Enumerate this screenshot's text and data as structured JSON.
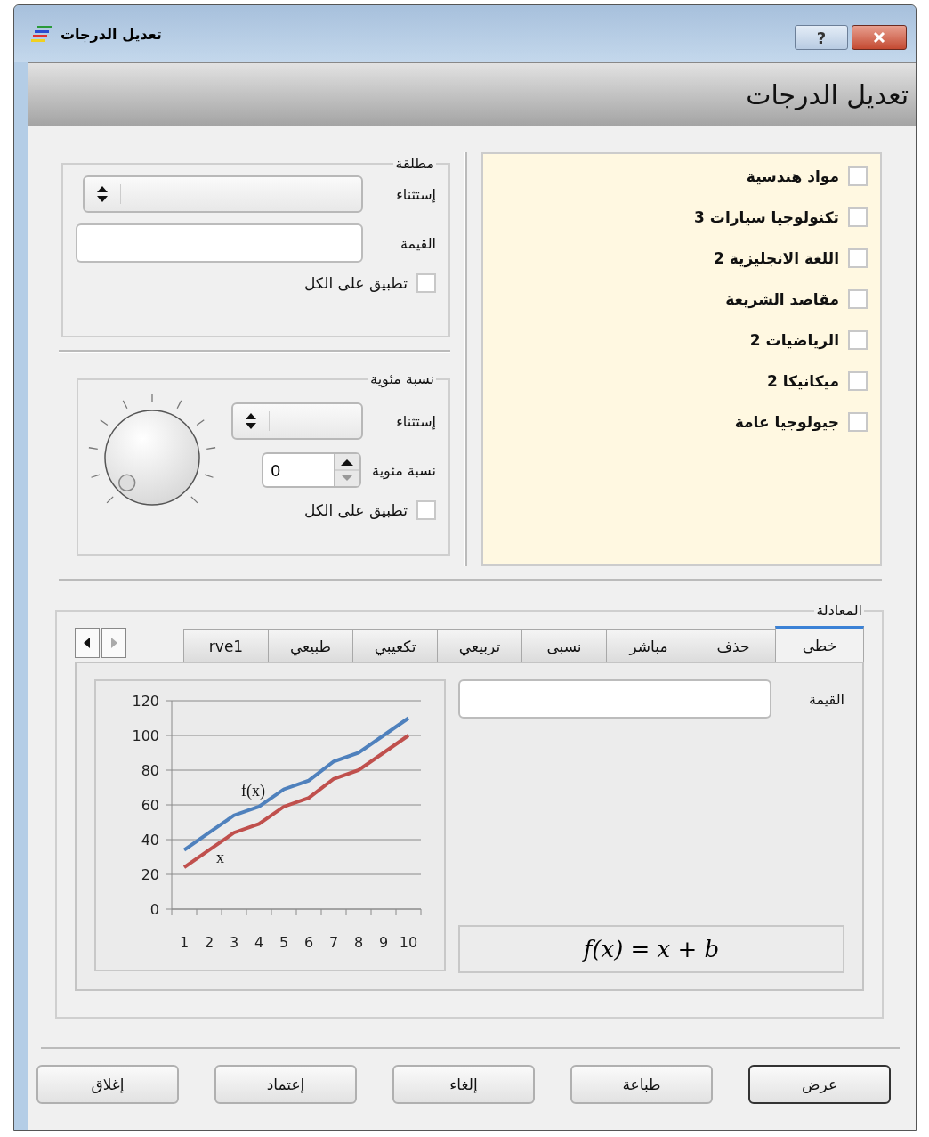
{
  "window": {
    "title": "تعديل الدرجات",
    "help_button": "?"
  },
  "header": {
    "title": "تعديل الدرجات"
  },
  "subjects": [
    {
      "label": "مواد هندسية",
      "checked": false
    },
    {
      "label": "تكنولوجيا سيارات 3",
      "checked": false
    },
    {
      "label": "اللغة الانجليزية 2",
      "checked": false
    },
    {
      "label": "مقاصد الشريعة",
      "checked": false
    },
    {
      "label": "الرياضيات 2",
      "checked": false
    },
    {
      "label": "ميكانيكا 2",
      "checked": false
    },
    {
      "label": "جيولوجيا عامة",
      "checked": false
    }
  ],
  "absolute_group": {
    "title": "مطلقة",
    "exception_label": "إستثناء",
    "value_label": "القيمة",
    "apply_all": {
      "label": "تطبيق على الكل",
      "checked": false
    }
  },
  "percent_group": {
    "title": "نسبة مئوية",
    "exception_label": "إستثناء",
    "percent_label": "نسبة مئوية",
    "percent_value": "0",
    "apply_all": {
      "label": "تطبيق على الكل",
      "checked": false
    }
  },
  "equation": {
    "title": "المعادلة",
    "tabs": [
      {
        "label": "خطى",
        "selected": true
      },
      {
        "label": "حذف",
        "selected": false
      },
      {
        "label": "مباشر",
        "selected": false
      },
      {
        "label": "نسبى",
        "selected": false
      },
      {
        "label": "تربيعي",
        "selected": false
      },
      {
        "label": "تكعيبي",
        "selected": false
      },
      {
        "label": "طبيعي",
        "selected": false
      },
      {
        "label": "rve1",
        "selected": false
      }
    ],
    "value_label": "القيمة",
    "formula": "f(x) = x + b",
    "chart_data": {
      "type": "line",
      "categories": [
        "1",
        "2",
        "3",
        "4",
        "5",
        "6",
        "7",
        "8",
        "9",
        "10"
      ],
      "series": [
        {
          "name": "f(x)",
          "color": "#4f81bd",
          "values": [
            34,
            44,
            54,
            59,
            69,
            74,
            85,
            90,
            100,
            110
          ]
        },
        {
          "name": "x",
          "color": "#c0504d",
          "values": [
            24,
            34,
            44,
            49,
            59,
            64,
            75,
            80,
            90,
            100
          ]
        }
      ],
      "ylim": [
        0,
        120
      ],
      "yticks": [
        0,
        20,
        40,
        60,
        80,
        100,
        120
      ],
      "grid": true
    }
  },
  "buttons": [
    {
      "label": "عرض",
      "default": true
    },
    {
      "label": "طباعة",
      "default": false
    },
    {
      "label": "إلغاء",
      "default": false
    },
    {
      "label": "إعتماد",
      "default": false
    },
    {
      "label": "إغلاق",
      "default": false
    }
  ]
}
